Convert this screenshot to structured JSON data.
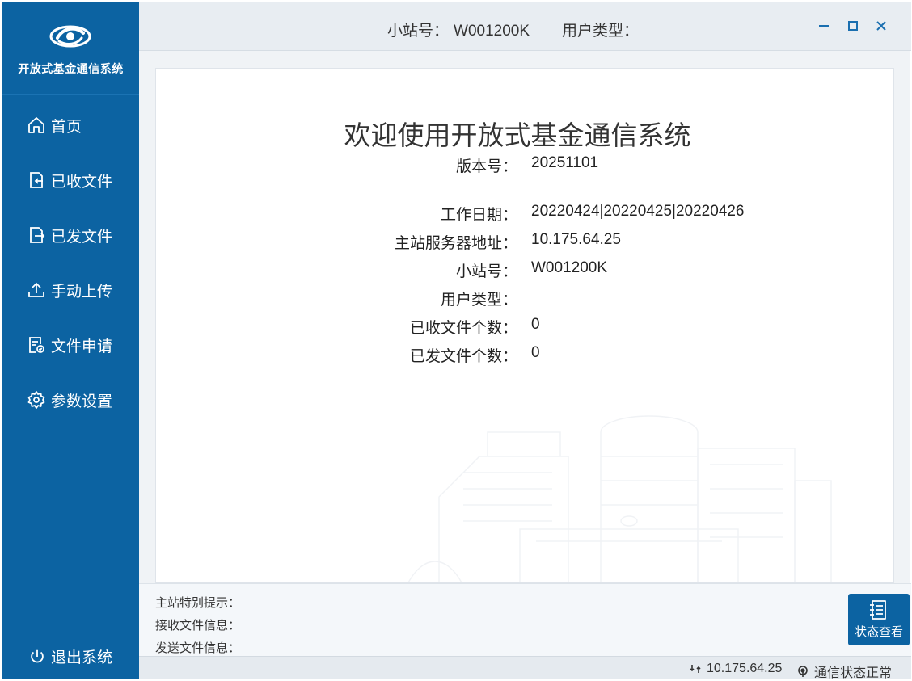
{
  "brand": {
    "title": "开放式基金通信系统",
    "logo_icon": "swirl-logo-icon"
  },
  "sidebar": {
    "items": [
      {
        "label": "首页",
        "icon": "home-icon"
      },
      {
        "label": "已收文件",
        "icon": "file-received-icon"
      },
      {
        "label": "已发文件",
        "icon": "file-sent-icon"
      },
      {
        "label": "手动上传",
        "icon": "upload-icon"
      },
      {
        "label": "文件申请",
        "icon": "file-request-icon"
      },
      {
        "label": "参数设置",
        "icon": "gear-icon"
      }
    ],
    "logout_label": "退出系统"
  },
  "topbar": {
    "station_label": "小站号：",
    "station_value": "W001200K",
    "user_type_label": "用户类型："
  },
  "main": {
    "title": "欢迎使用开放式基金通信系统",
    "info": [
      {
        "label": "版本号：",
        "value": "20251101"
      },
      {
        "label": "工作日期：",
        "value": "20220424|20220425|20220426"
      },
      {
        "label": "主站服务器地址：",
        "value": "10.175.64.25"
      },
      {
        "label": "小站号：",
        "value": "W001200K"
      },
      {
        "label": "用户类型：",
        "value": ""
      },
      {
        "label": "已收文件个数：",
        "value": "0"
      },
      {
        "label": "已发文件个数：",
        "value": "0"
      }
    ]
  },
  "messages": {
    "notice_label": "主站特别提示：",
    "receive_label": "接收文件信息：",
    "send_label": "发送文件信息："
  },
  "status_button": {
    "label": "状态查看",
    "icon": "list-icon"
  },
  "statusbar": {
    "server_ip": "10.175.64.25",
    "comm_status": "通信状态正常"
  },
  "colors": {
    "sidebar": "#0c63a2",
    "topbar": "#e8edf2",
    "accent": "#0c63a2"
  }
}
